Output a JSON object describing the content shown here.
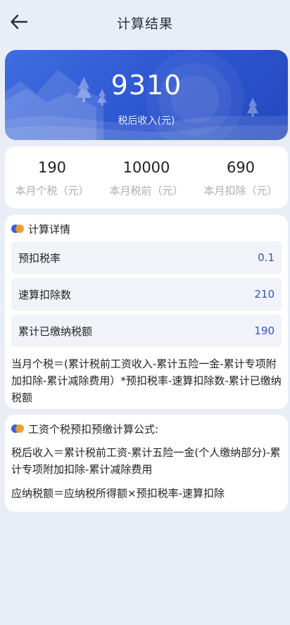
{
  "header": {
    "title": "计算结果"
  },
  "banner": {
    "amount": "9310",
    "label": "税后收入(元)"
  },
  "summary": [
    {
      "value": "190",
      "label": "本月个税（元）"
    },
    {
      "value": "10000",
      "label": "本月税前（元）"
    },
    {
      "value": "690",
      "label": "本月扣除（元）"
    }
  ],
  "details": {
    "title": "计算详情",
    "rows": [
      {
        "label": "预扣税率",
        "value": "0.1"
      },
      {
        "label": "速算扣除数",
        "value": "210"
      },
      {
        "label": "累计已缴纳税额",
        "value": "190"
      }
    ],
    "formula": "当月个税＝(累计税前工资收入-累计五险一金-累计专项附加扣除-累计减除费用）*预扣税率-速算扣除数-累计已缴纳税额"
  },
  "formulas": {
    "title": "工资个税预扣预缴计算公式:",
    "lines": [
      "税后收入＝累计税前工资-累计五险一金(个人缴纳部分)-累计专项附加扣除-累计减除费用",
      "应纳税额＝应纳税所得额×预扣税率-速算扣除"
    ]
  },
  "colors": {
    "accent": "#2f55c5",
    "banner": "#3560d6",
    "dot_secondary": "#f39a27",
    "background": "#e9edf6"
  },
  "icons": [
    "back-arrow-icon",
    "dual-dot-icon"
  ]
}
